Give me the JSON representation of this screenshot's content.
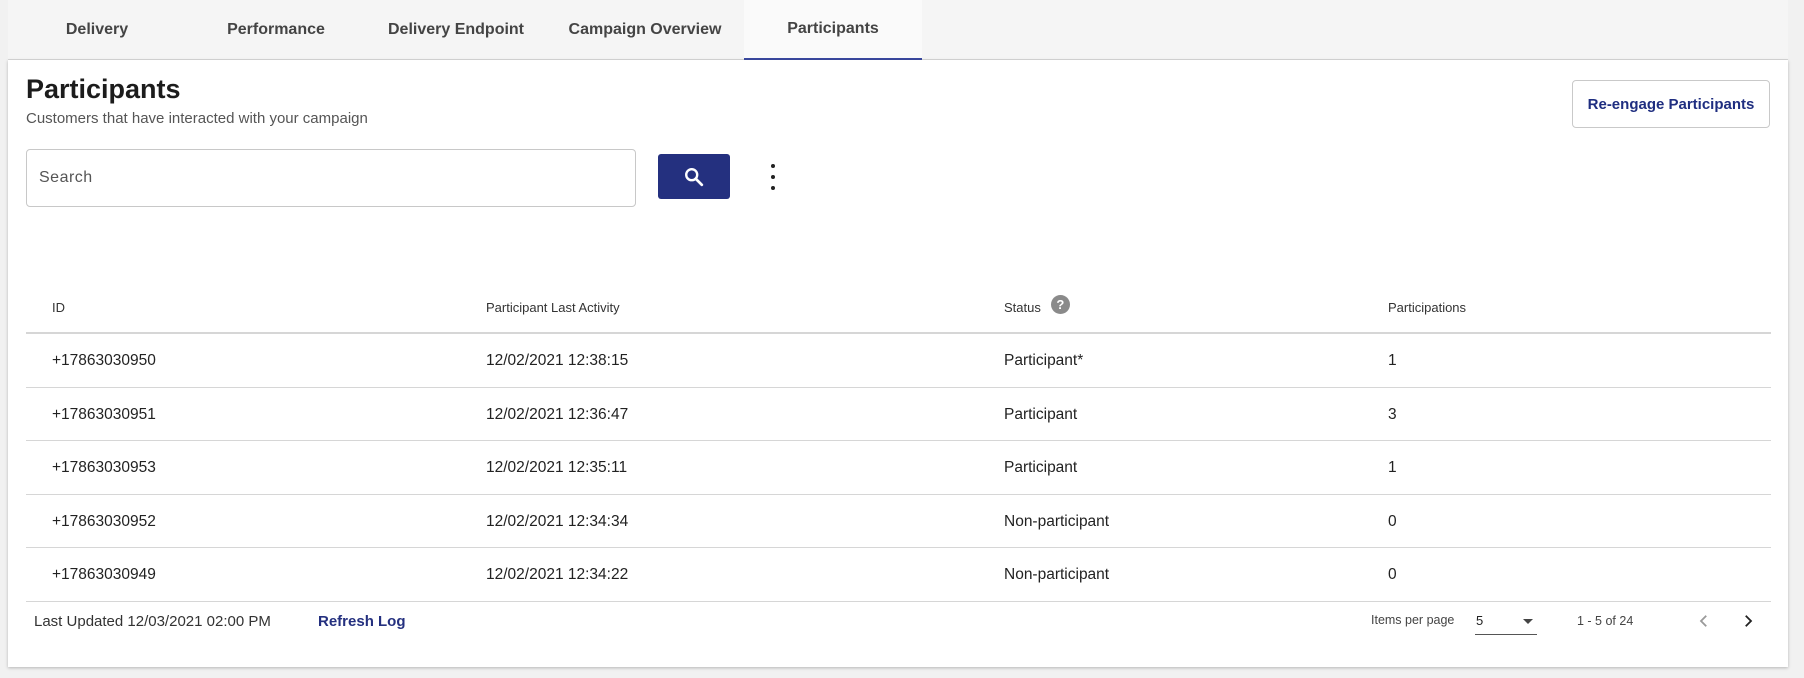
{
  "tabs": [
    {
      "label": "Delivery",
      "active": false
    },
    {
      "label": "Performance",
      "active": false
    },
    {
      "label": "Delivery Endpoint",
      "active": false
    },
    {
      "label": "Campaign Overview",
      "active": false
    },
    {
      "label": "Participants",
      "active": true
    }
  ],
  "page": {
    "title": "Participants",
    "subtitle": "Customers that have interacted with your campaign",
    "reengage_label": "Re-engage Participants"
  },
  "search": {
    "placeholder": "Search",
    "value": ""
  },
  "icons": {
    "search_button": "search-icon",
    "more": "more-vertical-icon",
    "status_help": "help-icon",
    "ipp_dropdown": "caret-down-icon",
    "prev": "chevron-left-icon",
    "next": "chevron-right-icon"
  },
  "colors": {
    "accent": "#24307f",
    "tab_active_underline": "#3a4aa0"
  },
  "table": {
    "headers": {
      "id": "ID",
      "last_activity": "Participant Last Activity",
      "status": "Status",
      "participations": "Participations",
      "status_help_glyph": "?"
    },
    "rows": [
      {
        "id": "+17863030950",
        "last_activity": "12/02/2021 12:38:15",
        "status": "Participant*",
        "participations": "1"
      },
      {
        "id": "+17863030951",
        "last_activity": "12/02/2021 12:36:47",
        "status": "Participant",
        "participations": "3"
      },
      {
        "id": "+17863030953",
        "last_activity": "12/02/2021 12:35:11",
        "status": "Participant",
        "participations": "1"
      },
      {
        "id": "+17863030952",
        "last_activity": "12/02/2021 12:34:34",
        "status": "Non-participant",
        "participations": "0"
      },
      {
        "id": "+17863030949",
        "last_activity": "12/02/2021 12:34:22",
        "status": "Non-participant",
        "participations": "0"
      }
    ]
  },
  "footer": {
    "last_updated": "Last Updated 12/03/2021 02:00 PM",
    "refresh_label": "Refresh Log",
    "items_per_page_label": "Items per page",
    "items_per_page_value": "5",
    "range_label": "1 - 5 of 24"
  }
}
